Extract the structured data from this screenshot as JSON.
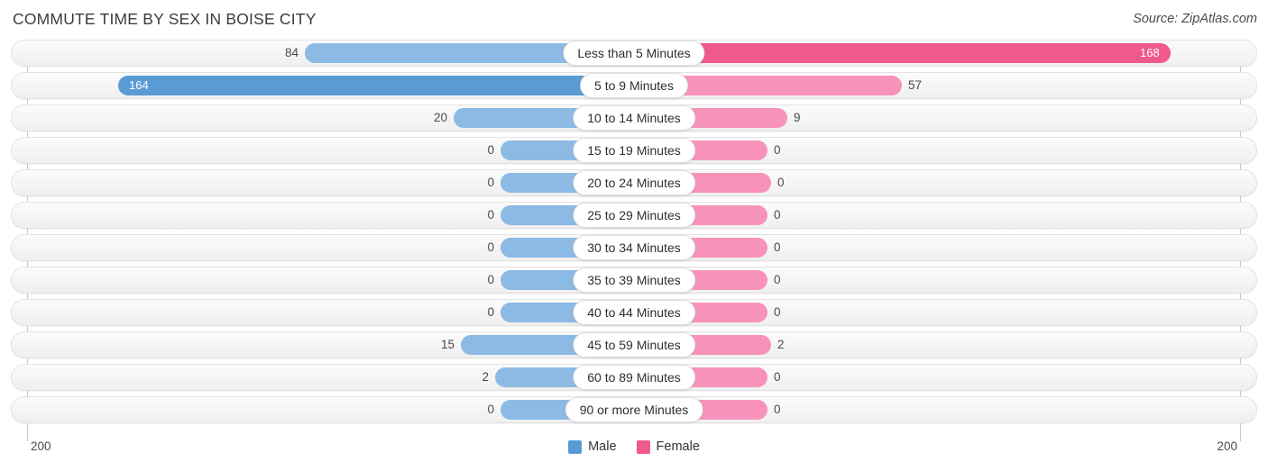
{
  "header": {
    "title": "COMMUTE TIME BY SEX IN BOISE CITY",
    "source": "Source: ZipAtlas.com"
  },
  "axis": {
    "left_max": "200",
    "right_max": "200"
  },
  "legend": {
    "items": [
      {
        "label": "Male",
        "color": "#5b9bd5"
      },
      {
        "label": "Female",
        "color": "#f0598e"
      }
    ]
  },
  "colors": {
    "male_light": "#8cbae4",
    "male_strong": "#5b9bd5",
    "female_light": "#f792bb",
    "female_strong": "#f0598e",
    "track": "#f5f5f5",
    "text": "#4a4a4a"
  },
  "chart_data": {
    "type": "bar",
    "subtype": "diverging-bidirectional",
    "title": "COMMUTE TIME BY SEX IN BOISE CITY",
    "xlabel": "",
    "ylabel": "",
    "xlim": [
      200,
      200
    ],
    "axis_max": 200,
    "grid": false,
    "legend_position": "bottom-center",
    "categories": [
      "Less than 5 Minutes",
      "5 to 9 Minutes",
      "10 to 14 Minutes",
      "15 to 19 Minutes",
      "20 to 24 Minutes",
      "25 to 29 Minutes",
      "30 to 34 Minutes",
      "35 to 39 Minutes",
      "40 to 44 Minutes",
      "45 to 59 Minutes",
      "60 to 89 Minutes",
      "90 or more Minutes"
    ],
    "series": [
      {
        "name": "Male",
        "side": "left",
        "color": "#5b9bd5",
        "values": [
          84,
          164,
          20,
          0,
          0,
          0,
          0,
          0,
          0,
          15,
          2,
          0
        ]
      },
      {
        "name": "Female",
        "side": "right",
        "color": "#f0598e",
        "values": [
          168,
          57,
          9,
          0,
          1,
          0,
          0,
          0,
          0,
          2,
          0,
          0
        ]
      }
    ]
  },
  "rows": [
    {
      "category": "Less than 5 Minutes",
      "male": "84",
      "female": "168",
      "male_w": 365,
      "female_w": 595,
      "male_in": false,
      "female_in": true,
      "male_strong": false,
      "female_strong": true
    },
    {
      "category": "5 to 9 Minutes",
      "male": "164",
      "female": "57",
      "male_w": 572,
      "female_w": 297,
      "male_in": true,
      "female_in": false,
      "male_strong": true,
      "female_strong": false
    },
    {
      "category": "10 to 14 Minutes",
      "male": "20",
      "female": "9",
      "male_w": 200,
      "female_w": 170,
      "male_in": false,
      "female_in": false,
      "male_strong": false,
      "female_strong": false
    },
    {
      "category": "15 to 19 Minutes",
      "male": "0",
      "female": "0",
      "male_w": 148,
      "female_w": 148,
      "male_in": false,
      "female_in": false,
      "male_strong": false,
      "female_strong": false
    },
    {
      "category": "20 to 24 Minutes",
      "male": "0",
      "female": "0",
      "male_w": 148,
      "female_w": 152,
      "male_in": false,
      "female_in": false,
      "male_strong": false,
      "female_strong": false
    },
    {
      "category": "25 to 29 Minutes",
      "male": "0",
      "female": "0",
      "male_w": 148,
      "female_w": 148,
      "male_in": false,
      "female_in": false,
      "male_strong": false,
      "female_strong": false
    },
    {
      "category": "30 to 34 Minutes",
      "male": "0",
      "female": "0",
      "male_w": 148,
      "female_w": 148,
      "male_in": false,
      "female_in": false,
      "male_strong": false,
      "female_strong": false
    },
    {
      "category": "35 to 39 Minutes",
      "male": "0",
      "female": "0",
      "male_w": 148,
      "female_w": 148,
      "male_in": false,
      "female_in": false,
      "male_strong": false,
      "female_strong": false
    },
    {
      "category": "40 to 44 Minutes",
      "male": "0",
      "female": "0",
      "male_w": 148,
      "female_w": 148,
      "male_in": false,
      "female_in": false,
      "male_strong": false,
      "female_strong": false
    },
    {
      "category": "45 to 59 Minutes",
      "male": "15",
      "female": "2",
      "male_w": 192,
      "female_w": 152,
      "male_in": false,
      "female_in": false,
      "male_strong": false,
      "female_strong": false
    },
    {
      "category": "60 to 89 Minutes",
      "male": "2",
      "female": "0",
      "male_w": 154,
      "female_w": 148,
      "male_in": false,
      "female_in": false,
      "male_strong": false,
      "female_strong": false
    },
    {
      "category": "90 or more Minutes",
      "male": "0",
      "female": "0",
      "male_w": 148,
      "female_w": 148,
      "male_in": false,
      "female_in": false,
      "male_strong": false,
      "female_strong": false
    }
  ]
}
